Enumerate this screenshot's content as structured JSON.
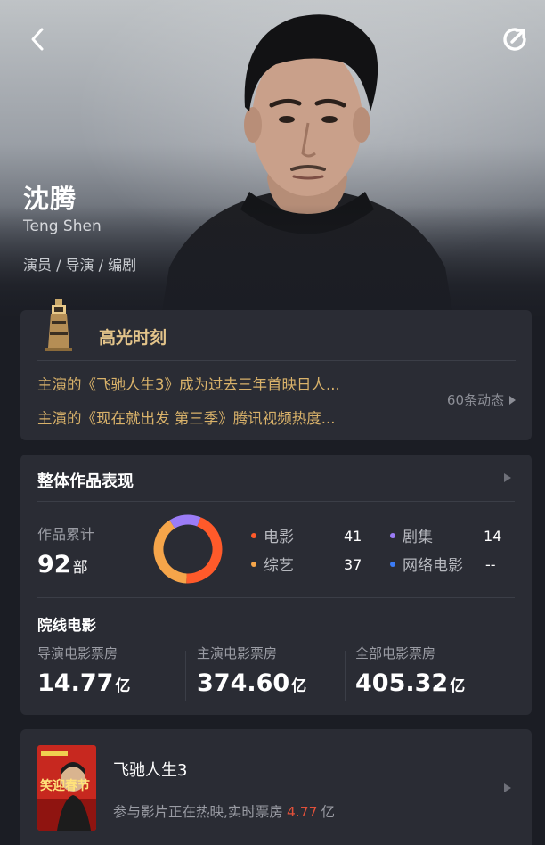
{
  "header": {
    "back_icon": "chevron-left-icon",
    "share_icon": "share-icon"
  },
  "profile": {
    "name_cn": "沈腾",
    "name_en": "Teng Shen",
    "roles": "演员 / 导演 / 编剧"
  },
  "highlights": {
    "title": "高光时刻",
    "items": [
      "主演的《飞驰人生3》成为过去三年首映日人...",
      "主演的《现在就出发 第三季》腾讯视频热度..."
    ],
    "more_label": "60条动态"
  },
  "works": {
    "title": "整体作品表现",
    "total_label": "作品累计",
    "total_value": "92",
    "total_unit": "部",
    "legend": [
      {
        "label": "电影",
        "value": "41",
        "color": "#ff5a2a"
      },
      {
        "label": "剧集",
        "value": "14",
        "color": "#9b7cf6"
      },
      {
        "label": "综艺",
        "value": "37",
        "color": "#f5a54a"
      },
      {
        "label": "网络电影",
        "value": "--",
        "color": "#3b7cf6"
      }
    ],
    "cinema_title": "院线电影",
    "box_office": [
      {
        "label": "导演电影票房",
        "value": "14.77",
        "unit": "亿"
      },
      {
        "label": "主演电影票房",
        "value": "374.60",
        "unit": "亿"
      },
      {
        "label": "全部电影票房",
        "value": "405.32",
        "unit": "亿"
      }
    ]
  },
  "movie": {
    "title": "飞驰人生3",
    "sub_prefix": "参与影片正在热映,实时票房",
    "sub_value": "4.77",
    "sub_unit": "亿",
    "poster_text": "笑迎春节",
    "poster_icon": "movie-poster"
  },
  "chart_data": {
    "type": "pie",
    "categories": [
      "电影",
      "综艺",
      "剧集",
      "网络电影"
    ],
    "values": [
      41,
      37,
      14,
      0
    ],
    "colors": [
      "#ff5a2a",
      "#f5a54a",
      "#9b7cf6",
      "#3b7cf6"
    ]
  }
}
